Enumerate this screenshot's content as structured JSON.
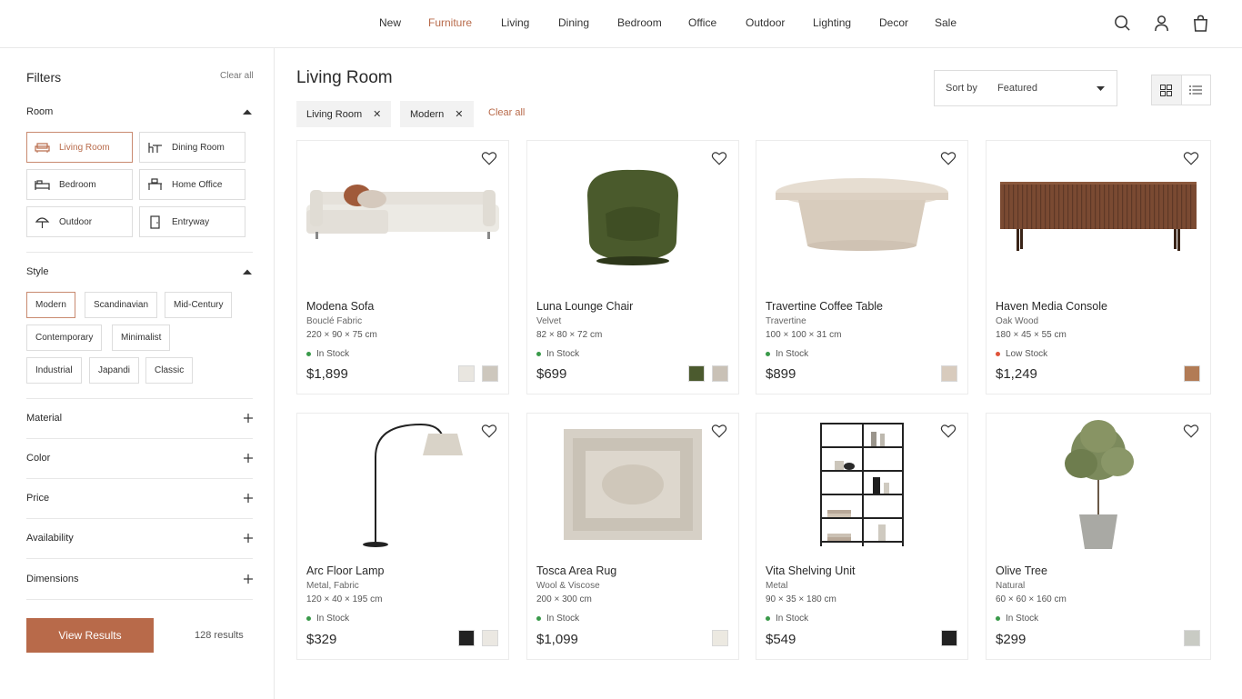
{
  "nav": {
    "links": [
      "New",
      "Furniture",
      "Living",
      "Dining",
      "Bedroom",
      "Office",
      "Outdoor",
      "Lighting",
      "Decor",
      "Sale"
    ],
    "icons": [
      "search-icon",
      "account-icon",
      "bag-icon"
    ]
  },
  "sidebar": {
    "title": "Filters",
    "clear_label": "Clear all",
    "room": {
      "label": "Room",
      "options": [
        "Living Room",
        "Dining Room",
        "Bedroom",
        "Home Office",
        "Outdoor",
        "Entryway"
      ],
      "selected": "Living Room"
    },
    "style": {
      "label": "Style",
      "options": [
        "Modern",
        "Scandinavian",
        "Mid-Century",
        "Contemporary",
        "Minimalist",
        "Industrial",
        "Japandi",
        "Classic"
      ],
      "selected": "Modern"
    },
    "collapsed_sections": [
      "Material",
      "Color",
      "Price",
      "Availability",
      "Dimensions"
    ],
    "view_results_label": "View Results",
    "results_count": "128 results"
  },
  "main": {
    "title": "Living Room",
    "sort": {
      "label": "Sort by",
      "value": "Featured"
    },
    "active_filters": [
      "Living Room",
      "Modern"
    ],
    "clear_label": "Clear all",
    "view_modes": [
      "grid-icon",
      "list-icon"
    ],
    "products": [
      {
        "name": "Modena Sofa",
        "material": "Bouclé Fabric",
        "dims": "220 × 90 × 75 cm",
        "stock": "In Stock",
        "stock_color": "#3a9a4a",
        "price": "$1,899",
        "swatches": [
          "#e9e6e0",
          "#cdc7bd"
        ],
        "image": "sofa"
      },
      {
        "name": "Luna Lounge Chair",
        "material": "Velvet",
        "dims": "82 × 80 × 72 cm",
        "stock": "In Stock",
        "stock_color": "#3a9a4a",
        "price": "$699",
        "swatches": [
          "#4b5a2e",
          "#c9c1b6"
        ],
        "image": "chair"
      },
      {
        "name": "Travertine Coffee Table",
        "material": "Travertine",
        "dims": "100 × 100 × 31 cm",
        "stock": "In Stock",
        "stock_color": "#3a9a4a",
        "price": "$899",
        "swatches": [
          "#d8cbbd"
        ],
        "image": "table"
      },
      {
        "name": "Haven Media Console",
        "material": "Oak Wood",
        "dims": "180 × 45 × 55 cm",
        "stock": "Low Stock",
        "stock_color": "#e0533a",
        "price": "$1,249",
        "swatches": [
          "#b27b55"
        ],
        "image": "console"
      },
      {
        "name": "Arc Floor Lamp",
        "material": "Metal, Fabric",
        "dims": "120 × 40 × 195 cm",
        "stock": "In Stock",
        "stock_color": "#3a9a4a",
        "price": "$329",
        "swatches": [
          "#222222",
          "#ebe8e2"
        ],
        "image": "lamp"
      },
      {
        "name": "Tosca Area Rug",
        "material": "Wool & Viscose",
        "dims": "200 × 300 cm",
        "stock": "In Stock",
        "stock_color": "#3a9a4a",
        "price": "$1,099",
        "swatches": [
          "#ece9e1"
        ],
        "image": "rug"
      },
      {
        "name": "Vita Shelving Unit",
        "material": "Metal",
        "dims": "90 × 35 × 180 cm",
        "stock": "In Stock",
        "stock_color": "#3a9a4a",
        "price": "$549",
        "swatches": [
          "#222222"
        ],
        "image": "shelf"
      },
      {
        "name": "Olive Tree",
        "material": "Natural",
        "dims": "60 × 60 × 160 cm",
        "stock": "In Stock",
        "stock_color": "#3a9a4a",
        "price": "$299",
        "swatches": [
          "#c9cbc4"
        ],
        "image": "tree"
      }
    ]
  },
  "colors": {
    "accent": "#b86a4a",
    "border": "#e8e8e8"
  }
}
